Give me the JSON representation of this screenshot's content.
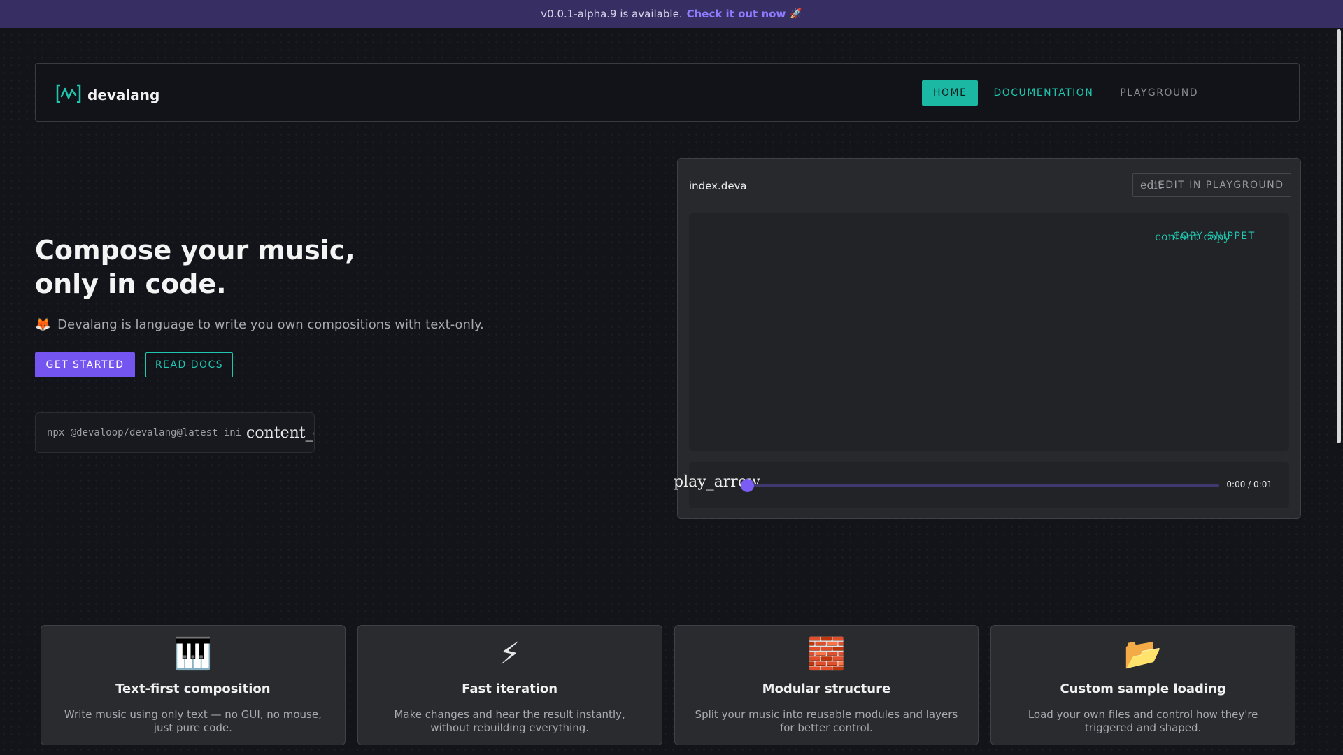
{
  "announcement": {
    "text": "v0.0.1-alpha.9 is available.",
    "link": "Check it out now",
    "rocket": "🚀"
  },
  "navbar": {
    "brand": "devalang",
    "items": [
      {
        "label": "HOME",
        "active": true
      },
      {
        "label": "DOCUMENTATION",
        "active": false
      },
      {
        "label": "PLAYGROUND",
        "active": false
      }
    ]
  },
  "hero": {
    "title_line1": "Compose your music,",
    "title_line2": "only in code.",
    "emoji": "🦊",
    "subtitle": "Devalang is language to write you own compositions with text-only.",
    "primary_button": "GET STARTED",
    "secondary_button": "READ DOCS",
    "install_command": "npx @devaloop/devalang@latest init",
    "copy_icon_text": "content_copy"
  },
  "editor": {
    "filename": "index.deva",
    "edit_icon_text": "edit",
    "edit_button": "EDIT IN PLAYGROUND",
    "copy_icon_text": "content_copy",
    "copy_button": "COPY SNIPPET",
    "code": "",
    "player": {
      "play_icon_text": "play_arrow",
      "time": "0:00 / 0:01",
      "progress": 0
    }
  },
  "features": [
    {
      "emoji": "🎹",
      "title": "Text-first composition",
      "description": "Write music using only text — no GUI, no mouse, just pure code."
    },
    {
      "emoji": "⚡",
      "title": "Fast iteration",
      "description": "Make changes and hear the result instantly, without rebuilding everything."
    },
    {
      "emoji": "🧱",
      "title": "Modular structure",
      "description": "Split your music into reusable modules and layers for better control."
    },
    {
      "emoji": "📂",
      "title": "Custom sample loading",
      "description": "Load your own files and control how they're triggered and shaped."
    }
  ],
  "colors": {
    "accent_purple": "#7555f0",
    "accent_teal": "#1bb8a4",
    "background": "#131419",
    "banner": "#372f63"
  }
}
